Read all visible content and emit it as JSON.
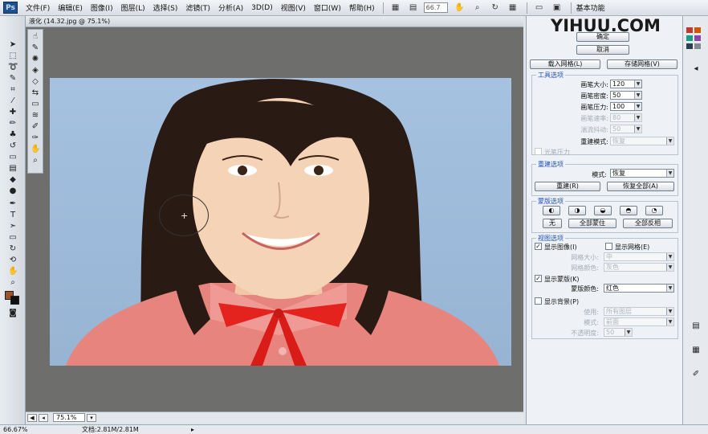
{
  "menubar": {
    "logo": "Ps",
    "items": [
      "文件(F)",
      "编辑(E)",
      "图像(I)",
      "图层(L)",
      "选择(S)",
      "滤镜(T)",
      "分析(A)",
      "3D(D)",
      "视图(V)",
      "窗口(W)",
      "帮助(H)"
    ],
    "zoom_dropdown": "66.7",
    "workspace": "基本功能"
  },
  "document": {
    "title": "液化 (14.32.jpg @ 75.1%)",
    "zoom": "75.1%"
  },
  "watermark": "YIHUU.COM",
  "panel": {
    "ok_label": "确定",
    "cancel_label": "取消",
    "load_mesh_label": "载入网格(L)",
    "save_mesh_label": "存储网格(V)",
    "tool_options": {
      "title": "工具选项",
      "brush_size_label": "画笔大小:",
      "brush_size_value": "120",
      "brush_density_label": "画笔密度:",
      "brush_density_value": "50",
      "brush_pressure_label": "画笔压力:",
      "brush_pressure_value": "100",
      "brush_rate_label": "画笔速率:",
      "brush_rate_value": "80",
      "turbulence_label": "湍流抖动:",
      "turbulence_value": "50",
      "reconstruct_mode_label": "重建模式:",
      "reconstruct_mode_value": "恢复",
      "stylus_pressure_label": "光笔压力"
    },
    "reconstruct": {
      "title": "重建选项",
      "mode_label": "模式:",
      "mode_value": "恢复",
      "reconstruct_button": "重建(R)",
      "restore_all_button": "恢复全部(A)"
    },
    "mask": {
      "title": "蒙版选项",
      "none_button": "无",
      "mask_all_button": "全部蒙住",
      "invert_all_button": "全部反相"
    },
    "view": {
      "title": "视图选项",
      "show_image_label": "显示图像(I)",
      "show_mesh_label": "显示网格(E)",
      "mesh_size_label": "网格大小:",
      "mesh_size_value": "中",
      "mesh_color_label": "网格颜色:",
      "mesh_color_value": "灰色",
      "show_mask_label": "显示蒙版(K)",
      "mask_color_label": "蒙版颜色:",
      "mask_color_value": "红色",
      "show_backdrop_label": "显示背景(P)",
      "use_label": "使用:",
      "use_value": "所有图层",
      "mode_label": "模式:",
      "mode_value": "前面",
      "opacity_label": "不透明度:",
      "opacity_value": "50"
    }
  },
  "statusbar": {
    "zoom": "66.67%",
    "doc_info": "文档:2.81M/2.81M"
  },
  "colors": {
    "foreground": "#a0522d",
    "background": "#111111"
  }
}
